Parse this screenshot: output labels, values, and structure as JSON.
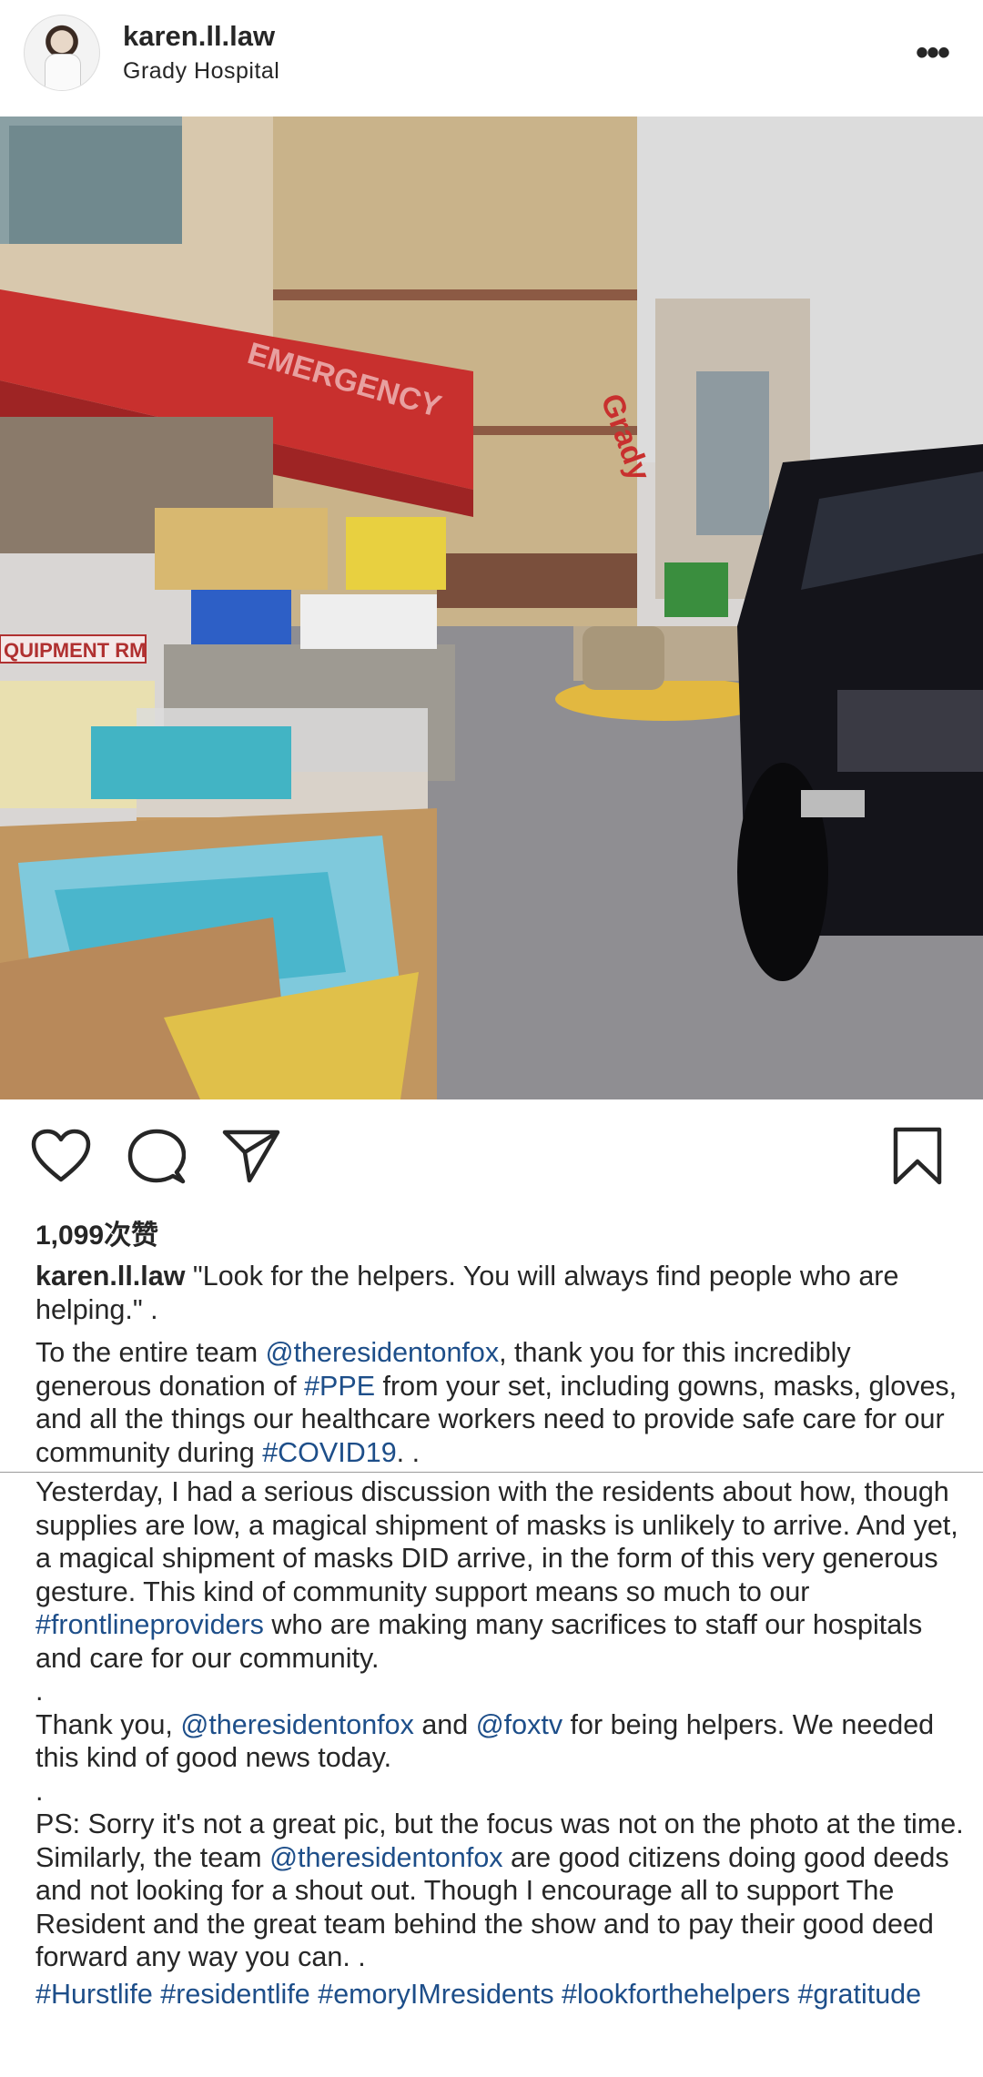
{
  "post": {
    "username": "karen.ll.law",
    "location": "Grady  Hospital",
    "more_label": "•••"
  },
  "photo": {
    "signs": {
      "emergency": "EMERGENCY",
      "grady": "Grady",
      "equipment": "QUIPMENT RM"
    }
  },
  "likes": "1,099次赞",
  "caption": {
    "username": "karen.ll.law",
    "line1": " \"Look for the helpers.  You will always find people who are helping.\" .",
    "p2_a": "To the entire team ",
    "p2_tag1": "@theresidentonfox",
    "p2_b": ", thank you for this incredibly generous donation of ",
    "p2_tag2": "#PPE",
    "p2_c": " from your set, including gowns, masks, gloves, and all the things our healthcare workers need to provide safe care for our community during ",
    "p2_tag3": "#COVID19",
    "p2_d": ". .",
    "p3_a": "Yesterday, I had a serious discussion with the residents about how, though supplies are low, a magical shipment of masks is unlikely to arrive.  And yet, a magical shipment of masks DID arrive, in the form of this very generous gesture.  This kind of community support means so much to our ",
    "p3_tag": "#frontlineproviders",
    "p3_b": " who are making many sacrifices to staff our hospitals and care for our community.",
    "dot1": ".",
    "p4_a": "Thank you, ",
    "p4_tag1": "@theresidentonfox",
    "p4_b": " and ",
    "p4_tag2": "@foxtv",
    "p4_c": " for being helpers. We needed this kind of good news today.",
    "dot2": ".",
    "p5_a": "PS: Sorry it's not a great pic, but the focus was not on the photo at the time.  Similarly, the team ",
    "p5_tag": "@theresidentonfox",
    "p5_b": " are good citizens doing good deeds and not looking for a shout out.  Though I encourage all to support The Resident and the great team behind the show and to pay their good deed forward any way you can. .",
    "hashtags": "#Hurstlife #residentlife #emoryIMresidents #lookforthehelpers #gratitude"
  }
}
